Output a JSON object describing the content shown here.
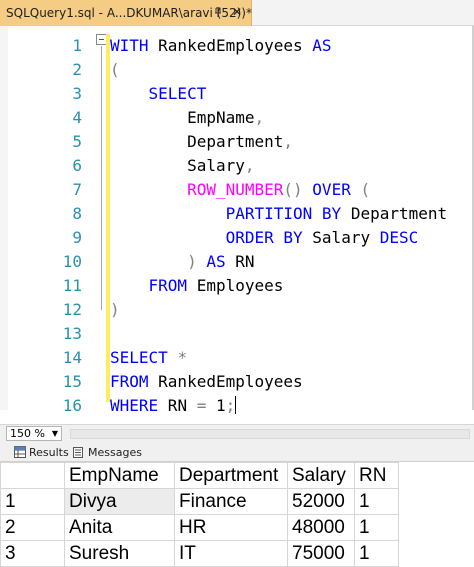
{
  "tab": {
    "title": "SQLQuery1.sql - A...DKUMAR\\aravi (52))*",
    "pin_icon": "pin-icon",
    "close_icon": "close-icon",
    "close_glyph": "✕"
  },
  "editor": {
    "line_numbers": [
      "1",
      "2",
      "3",
      "4",
      "5",
      "6",
      "7",
      "8",
      "9",
      "10",
      "11",
      "12",
      "13",
      "14",
      "15",
      "16"
    ],
    "lines": [
      [
        {
          "t": "kw",
          "v": "WITH"
        },
        {
          "t": "plain",
          "v": " RankedEmployees "
        },
        {
          "t": "kw",
          "v": "AS"
        }
      ],
      [
        {
          "t": "gray",
          "v": "("
        }
      ],
      [
        {
          "t": "plain",
          "v": "    "
        },
        {
          "t": "kw",
          "v": "SELECT"
        }
      ],
      [
        {
          "t": "plain",
          "v": "        EmpName"
        },
        {
          "t": "gray",
          "v": ","
        }
      ],
      [
        {
          "t": "plain",
          "v": "        Department"
        },
        {
          "t": "gray",
          "v": ","
        }
      ],
      [
        {
          "t": "plain",
          "v": "        Salary"
        },
        {
          "t": "gray",
          "v": ","
        }
      ],
      [
        {
          "t": "plain",
          "v": "        "
        },
        {
          "t": "fn",
          "v": "ROW_NUMBER"
        },
        {
          "t": "gray",
          "v": "()"
        },
        {
          "t": "plain",
          "v": " "
        },
        {
          "t": "kw",
          "v": "OVER"
        },
        {
          "t": "plain",
          "v": " "
        },
        {
          "t": "gray",
          "v": "("
        }
      ],
      [
        {
          "t": "plain",
          "v": "            "
        },
        {
          "t": "kw",
          "v": "PARTITION BY"
        },
        {
          "t": "plain",
          "v": " Department"
        }
      ],
      [
        {
          "t": "plain",
          "v": "            "
        },
        {
          "t": "kw",
          "v": "ORDER BY"
        },
        {
          "t": "plain",
          "v": " Salary "
        },
        {
          "t": "kw",
          "v": "DESC"
        }
      ],
      [
        {
          "t": "plain",
          "v": "        "
        },
        {
          "t": "gray",
          "v": ")"
        },
        {
          "t": "plain",
          "v": " "
        },
        {
          "t": "kw",
          "v": "AS"
        },
        {
          "t": "plain",
          "v": " RN"
        }
      ],
      [
        {
          "t": "plain",
          "v": "    "
        },
        {
          "t": "kw",
          "v": "FROM"
        },
        {
          "t": "plain",
          "v": " Employees"
        }
      ],
      [
        {
          "t": "gray",
          "v": ")"
        }
      ],
      [],
      [
        {
          "t": "kw",
          "v": "SELECT"
        },
        {
          "t": "plain",
          "v": " "
        },
        {
          "t": "gray",
          "v": "*"
        }
      ],
      [
        {
          "t": "kw",
          "v": "FROM"
        },
        {
          "t": "plain",
          "v": " RankedEmployees"
        }
      ],
      [
        {
          "t": "kw",
          "v": "WHERE"
        },
        {
          "t": "plain",
          "v": " RN "
        },
        {
          "t": "gray",
          "v": "="
        },
        {
          "t": "plain",
          "v": " 1"
        },
        {
          "t": "gray",
          "v": ";"
        }
      ]
    ],
    "caret_line": 16
  },
  "status": {
    "zoom": "150 %",
    "zoom_arrow": "▼"
  },
  "results_tabs": [
    {
      "label": "Results",
      "icon": "grid-icon"
    },
    {
      "label": "Messages",
      "icon": "messages-icon"
    }
  ],
  "results": {
    "columns": [
      "",
      "EmpName",
      "Department",
      "Salary",
      "RN"
    ],
    "rows": [
      [
        "1",
        "Divya",
        "Finance",
        "52000",
        "1"
      ],
      [
        "2",
        "Anita",
        "HR",
        "48000",
        "1"
      ],
      [
        "3",
        "Suresh",
        "IT",
        "75000",
        "1"
      ]
    ]
  },
  "colors": {
    "tab_active": "#f5cc84",
    "keyword": "#0000ff",
    "function": "#ff00ff",
    "operator": "#808080",
    "line_number": "#2b91af",
    "change_bar": "#ffee62"
  }
}
